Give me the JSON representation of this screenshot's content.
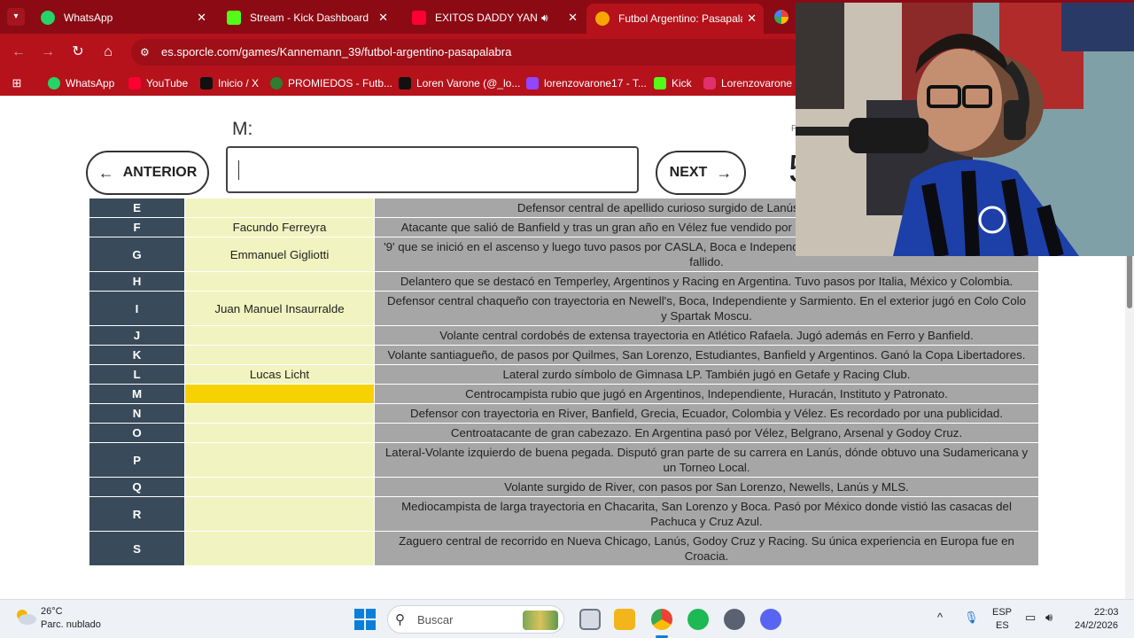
{
  "browser": {
    "tabs": [
      {
        "title": "WhatsApp",
        "color": "#25d366"
      },
      {
        "title": "Stream - Kick Dashboard",
        "color": "#53fc18"
      },
      {
        "title": "EXITOS DADDY YANKEE",
        "color": "#ff0033"
      },
      {
        "title": "Futbol Argentino: Pasapalabra",
        "color": "#f7a600"
      }
    ],
    "url": "es.sporcle.com/games/Kannemann_39/futbol-argentino-pasapalabra",
    "bookmarks": [
      {
        "label": "WhatsApp",
        "color": "#25d366"
      },
      {
        "label": "YouTube",
        "color": "#ff0033"
      },
      {
        "label": "Inicio / X",
        "color": "#000000"
      },
      {
        "label": "PROMIEDOS - Futb...",
        "color": "#2e7d32"
      },
      {
        "label": "Loren Varone (@_lo...",
        "color": "#000000"
      },
      {
        "label": "lorenzovarone17 - T...",
        "color": "#9146ff"
      },
      {
        "label": "Kick",
        "color": "#53fc18"
      },
      {
        "label": "Lorenzovarone (l",
        "color": "#e1306c"
      }
    ]
  },
  "quiz": {
    "current_letter": "M:",
    "prev_label": "ANTERIOR",
    "next_label": "NEXT",
    "score_glimpse": "5",
    "input_value": "",
    "rows": [
      {
        "letter": "E",
        "answer": "",
        "clue": "Defensor central de apellido curioso surgido de Lanús, que jugó también",
        "current": false
      },
      {
        "letter": "F",
        "answer": "Facundo Ferreyra",
        "clue": "Atacante que salió de Banfield y tras un gran año en Vélez fue vendido por pasó por Benfica, Espanyol y Celta, entre",
        "current": false
      },
      {
        "letter": "G",
        "answer": "Emmanuel Gigliotti",
        "clue": "'9' que se inició en el ascenso y luego tuvo pasos por CASLA, Boca e Independiente entre otros. Es recordado por un penal fallido.",
        "current": false
      },
      {
        "letter": "H",
        "answer": "",
        "clue": "Delantero que se destacó en Temperley, Argentinos y Racing en Argentina. Tuvo pasos por Italia, México y Colombia.",
        "current": false
      },
      {
        "letter": "I",
        "answer": "Juan Manuel Insaurralde",
        "clue": "Defensor central chaqueño con trayectoria en Newell's, Boca, Independiente y Sarmiento. En el exterior jugó en Colo Colo y Spartak Moscu.",
        "current": false
      },
      {
        "letter": "J",
        "answer": "",
        "clue": "Volante central cordobés de extensa trayectoria en Atlético Rafaela. Jugó además en Ferro y Banfield.",
        "current": false
      },
      {
        "letter": "K",
        "answer": "",
        "clue": "Volante santiagueño, de pasos por Quilmes, San Lorenzo, Estudiantes, Banfield y Argentinos. Ganó la Copa Libertadores.",
        "current": false
      },
      {
        "letter": "L",
        "answer": "Lucas Licht",
        "clue": "Lateral zurdo símbolo de Gimnasa LP. También jugó en Getafe y Racing Club.",
        "current": false
      },
      {
        "letter": "M",
        "answer": "",
        "clue": "Centrocampista rubio que jugó en Argentinos, Independiente, Huracán, Instituto y Patronato.",
        "current": true
      },
      {
        "letter": "N",
        "answer": "",
        "clue": "Defensor con trayectoria en River, Banfield, Grecia, Ecuador, Colombia y Vélez. Es recordado por una publicidad.",
        "current": false
      },
      {
        "letter": "O",
        "answer": "",
        "clue": "Centroatacante de gran cabezazo. En Argentina pasó por Vélez, Belgrano, Arsenal y Godoy Cruz.",
        "current": false
      },
      {
        "letter": "P",
        "answer": "",
        "clue": "Lateral-Volante izquierdo de buena pegada. Disputó gran parte de su carrera en Lanús, dónde obtuvo una Sudamericana y un Torneo Local.",
        "current": false
      },
      {
        "letter": "Q",
        "answer": "",
        "clue": "Volante surgido de River, con pasos por San Lorenzo, Newells, Lanús y MLS.",
        "current": false
      },
      {
        "letter": "R",
        "answer": "",
        "clue": "Mediocampista de larga trayectoria en Chacarita, San Lorenzo y Boca. Pasó por México donde vistió las casacas del Pachuca y Cruz Azul.",
        "current": false
      },
      {
        "letter": "S",
        "answer": "",
        "clue": "Zaguero central de recorrido en Nueva Chicago, Lanús, Godoy Cruz y Racing. Su única experiencia en Europa fue en Croacia.",
        "current": false
      }
    ]
  },
  "taskbar": {
    "weather_temp": "26°C",
    "weather_desc": "Parc. nublado",
    "search_label": "Buscar",
    "lang_top": "ESP",
    "lang_bottom": "ES",
    "time": "22:03",
    "date": "24/2/2026"
  },
  "colors": {
    "chrome_dark": "#8b0a14",
    "chrome": "#b5121b",
    "letter_cell": "#394a5a",
    "answer_cell": "#f1f4c0",
    "current_answer": "#f6d200",
    "clue_cell": "#a6a6a6"
  }
}
